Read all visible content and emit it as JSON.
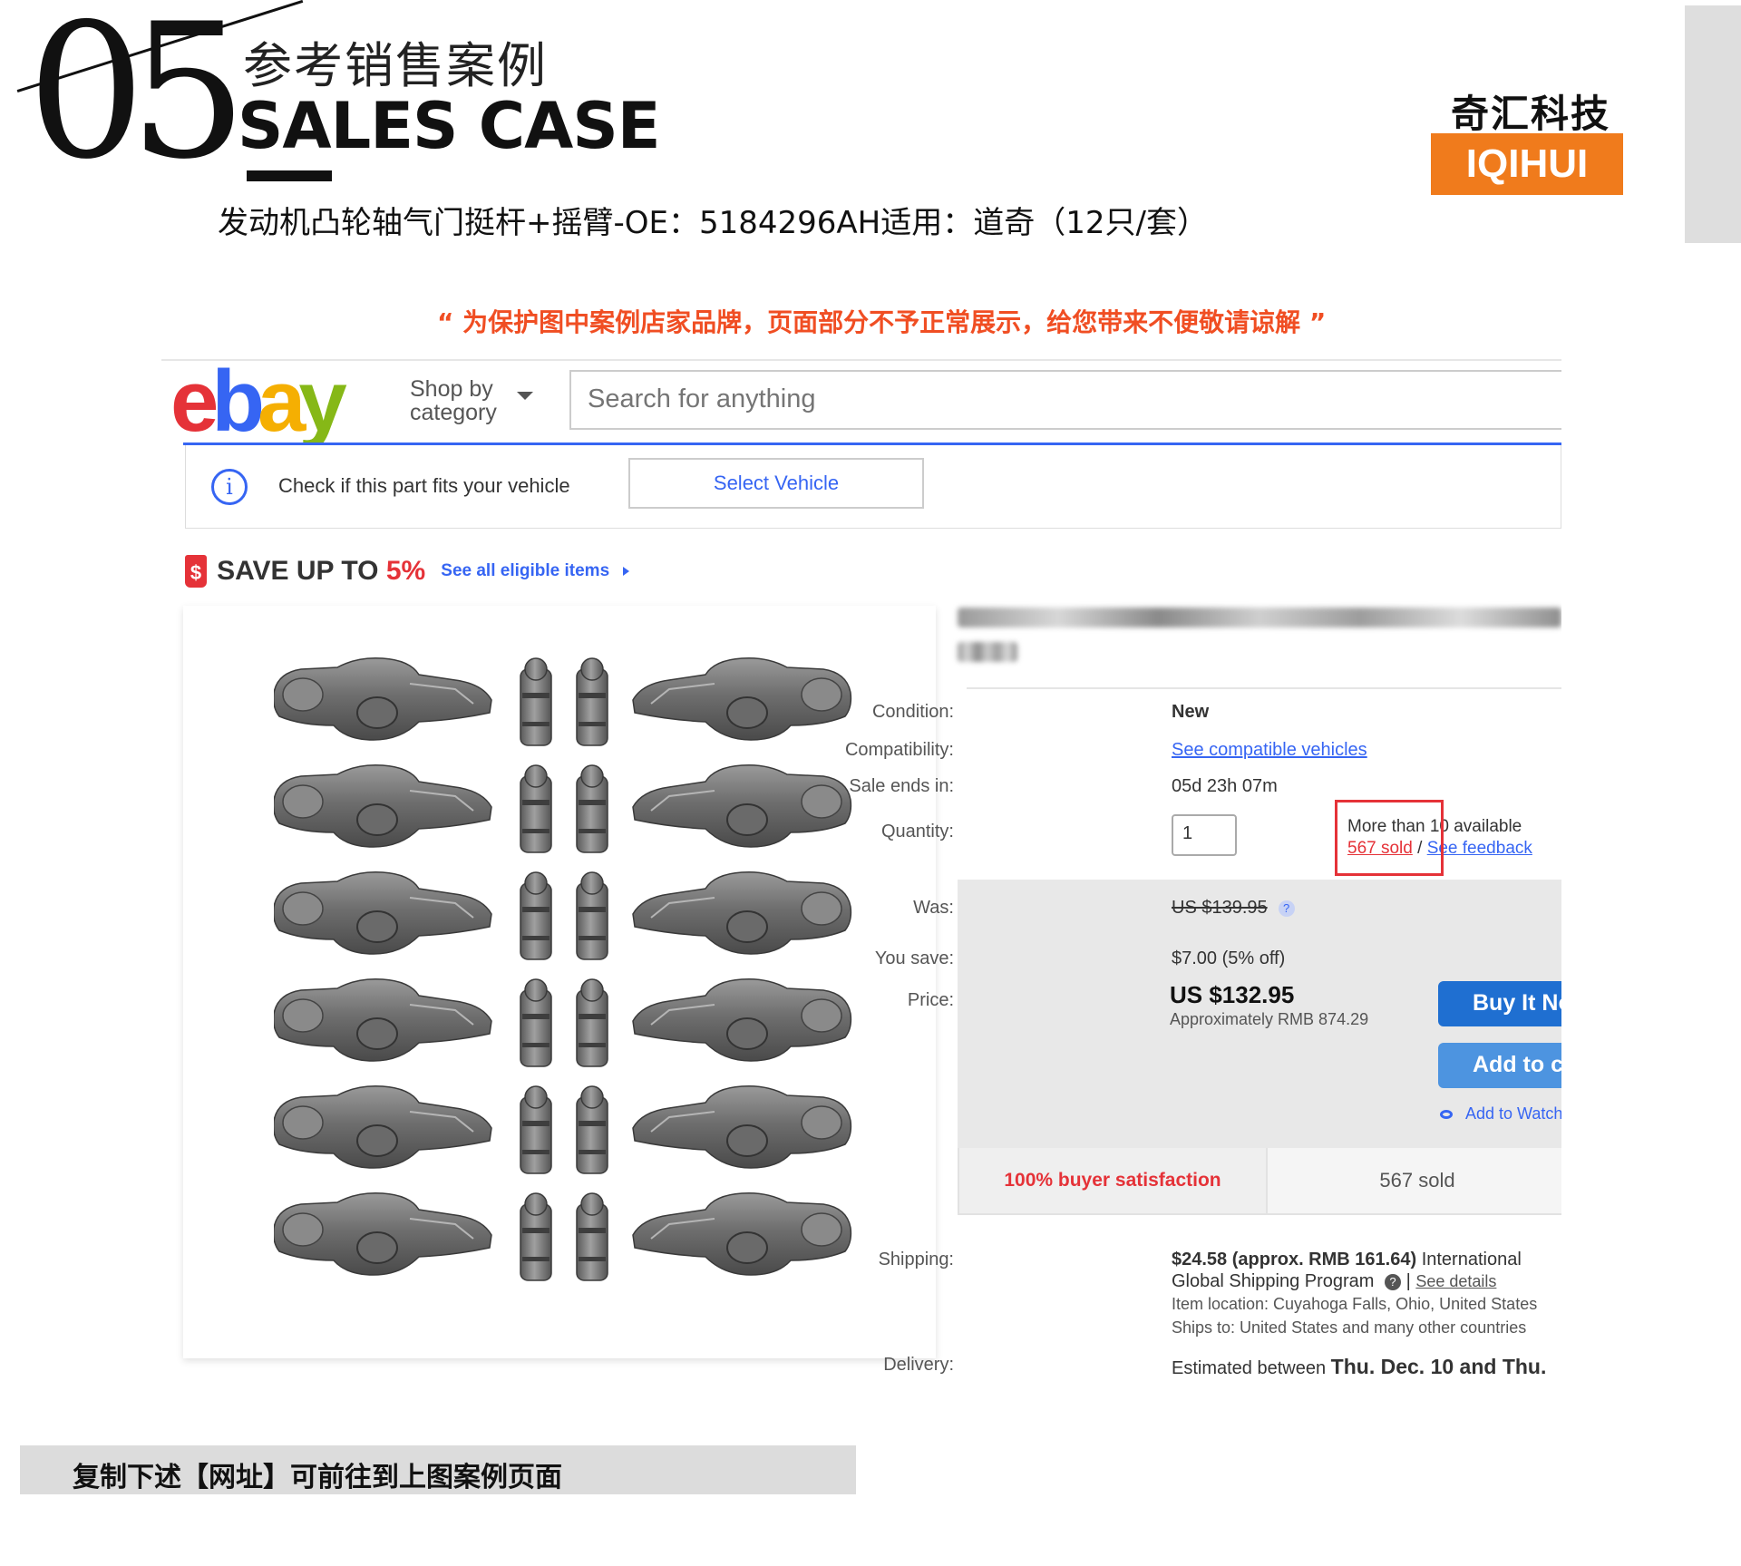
{
  "header": {
    "section_number": "05",
    "title_cn": "参考销售案例",
    "title_en": "SALES CASE",
    "product_title": "发动机凸轮轴气门挺杆+摇臂-OE：5184296AH适用：道奇（12只/套）",
    "brand_cn": "奇汇科技",
    "brand_en": "IQIHUI",
    "notice": "“ 为保护图中案例店家品牌，页面部分不予正常展示，给您带来不便敬请谅解 ”"
  },
  "colors": {
    "brand_orange": "#f07b1c",
    "notice_red": "#f04e23",
    "ebay_blue": "#3665f3",
    "ebay_red": "#e53238",
    "ebay_yellow": "#f5af02",
    "ebay_green": "#86b817"
  },
  "ebay": {
    "logo": [
      "e",
      "b",
      "a",
      "y"
    ],
    "shop_by_line1": "Shop by",
    "shop_by_line2": "category",
    "search_placeholder": "Search for anything",
    "vehicle_check_text": "Check if this part fits your vehicle",
    "select_vehicle_label": "Select Vehicle",
    "save_text": "SAVE UP TO ",
    "save_percent": "5%",
    "see_all_label": "See all eligible items",
    "listing": {
      "condition_label": "Condition:",
      "condition_value": "New",
      "compatibility_label": "Compatibility:",
      "compatibility_value": "See compatible vehicles",
      "sale_ends_label": "Sale ends in:",
      "sale_ends_value": "05d 23h 07m",
      "quantity_label": "Quantity:",
      "quantity_value": "1",
      "availability": "More than 10 available",
      "sold_link": "567 sold",
      "feedback_link": "See feedback",
      "was_label": "Was:",
      "was_value": "US $139.95",
      "you_save_label": "You save:",
      "you_save_value": "$7.00 (5% off)",
      "price_label": "Price:",
      "price_value": "US $132.95",
      "approx_value": "Approximately RMB 874.29",
      "buy_label": "Buy It Now",
      "cart_label": "Add to cart",
      "watch_label": "Add to Watchlist",
      "satisfaction": "100% buyer satisfaction",
      "sold_count": "567 sold",
      "shipping_label": "Shipping:",
      "shipping_value": "$24.58 (approx. RMB 161.64)",
      "shipping_tail": "International",
      "shipping_program": "Global Shipping Program",
      "see_details": "See details",
      "item_location": "Item location: Cuyahoga Falls, Ohio, United States",
      "ships_to": "Ships to: United States and many other countries",
      "delivery_label": "Delivery:",
      "delivery_value": "Estimated between",
      "delivery_dates": "Thu. Dec. 10 and Thu."
    }
  },
  "footer": {
    "text": "复制下述【网址】可前往到上图案例页面"
  }
}
